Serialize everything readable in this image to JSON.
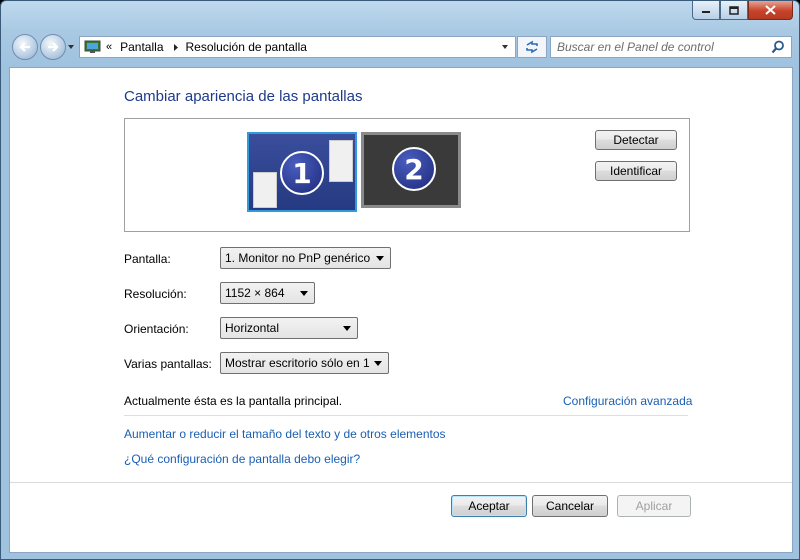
{
  "breadcrumb": {
    "items": [
      "Pantalla",
      "Resolución de pantalla"
    ]
  },
  "search": {
    "placeholder": "Buscar en el Panel de control"
  },
  "main": {
    "title": "Cambiar apariencia de las pantallas",
    "monitors": [
      "1",
      "2"
    ],
    "detect_label": "Detectar",
    "identify_label": "Identificar"
  },
  "settings": {
    "display": {
      "label": "Pantalla:",
      "value": "1. Monitor no PnP genérico"
    },
    "resolution": {
      "label": "Resolución:",
      "value": "1152 × 864"
    },
    "orientation": {
      "label": "Orientación:",
      "value": "Horizontal"
    },
    "multiple": {
      "label": "Varias pantallas:",
      "value": "Mostrar escritorio sólo en 1"
    }
  },
  "status_text": "Actualmente ésta es la pantalla principal.",
  "advanced_link": "Configuración avanzada",
  "links": {
    "text_size": "Aumentar o reducir el tamaño del texto y de otros elementos",
    "which_settings": "¿Qué configuración de pantalla debo elegir?"
  },
  "buttons": {
    "ok": "Aceptar",
    "cancel": "Cancelar",
    "apply": "Aplicar"
  },
  "colors": {
    "link": "#1a5fb4",
    "title": "#1e3a8a",
    "selected_monitor_border": "#3399dd"
  },
  "icons": [
    "minimize-icon",
    "maximize-icon",
    "close-icon",
    "back-arrow-icon",
    "forward-arrow-icon",
    "monitor-icon",
    "chevron-down-icon",
    "refresh-icon",
    "search-icon"
  ]
}
